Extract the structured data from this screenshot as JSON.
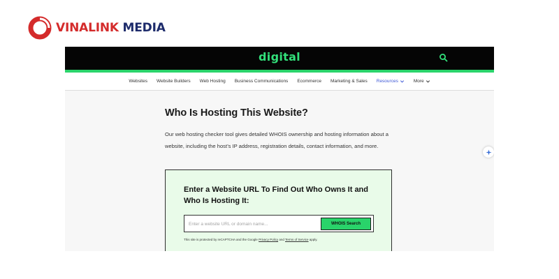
{
  "brand": {
    "name_part1": "VINALINK",
    "name_part2": "MEDIA"
  },
  "site": {
    "logo": "digital",
    "search_icon": "search-icon",
    "accent_color": "#2bd46b",
    "header_color": "#050505"
  },
  "nav": {
    "items": [
      {
        "label": "Websites"
      },
      {
        "label": "Website Builders"
      },
      {
        "label": "Web Hosting"
      },
      {
        "label": "Business Communications"
      },
      {
        "label": "Ecommerce"
      },
      {
        "label": "Marketing & Sales"
      },
      {
        "label": "Resources"
      },
      {
        "label": "More"
      }
    ],
    "active_color": "#3d57d6"
  },
  "article": {
    "title": "Who Is Hosting This Website?",
    "intro": "Our web hosting checker tool gives detailed WHOIS ownership and hosting information about a website, including the host’s IP address, registration details, contact information, and more."
  },
  "whois": {
    "title": "Enter a Website URL To Find Out Who Owns It and Who Is Hosting It:",
    "input_placeholder": "Enter a website URL or domain name...",
    "input_value": "",
    "button_label": "WHOIS Search",
    "recaptcha_prefix": "This site is protected by reCAPTCHA and the Google ",
    "privacy_link": "Privacy Policy",
    "recaptcha_and": " and ",
    "terms_link": "Terms of Service",
    "recaptcha_suffix": " apply."
  }
}
